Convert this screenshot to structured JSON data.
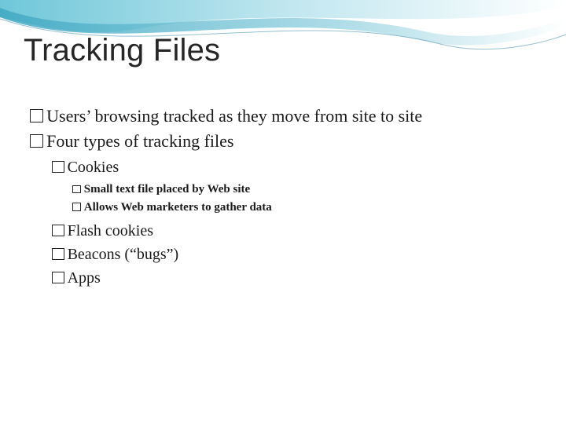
{
  "title": "Tracking Files",
  "bullets": {
    "b1": "Users’ browsing tracked as they move from site to site",
    "b2": "Four types of tracking files",
    "b2_1": "Cookies",
    "b2_1_a": "Small text file placed by Web site",
    "b2_1_b": "Allows Web marketers to gather data",
    "b2_2": "Flash cookies",
    "b2_3": "Beacons (“bugs”)",
    "b2_4": "Apps"
  }
}
